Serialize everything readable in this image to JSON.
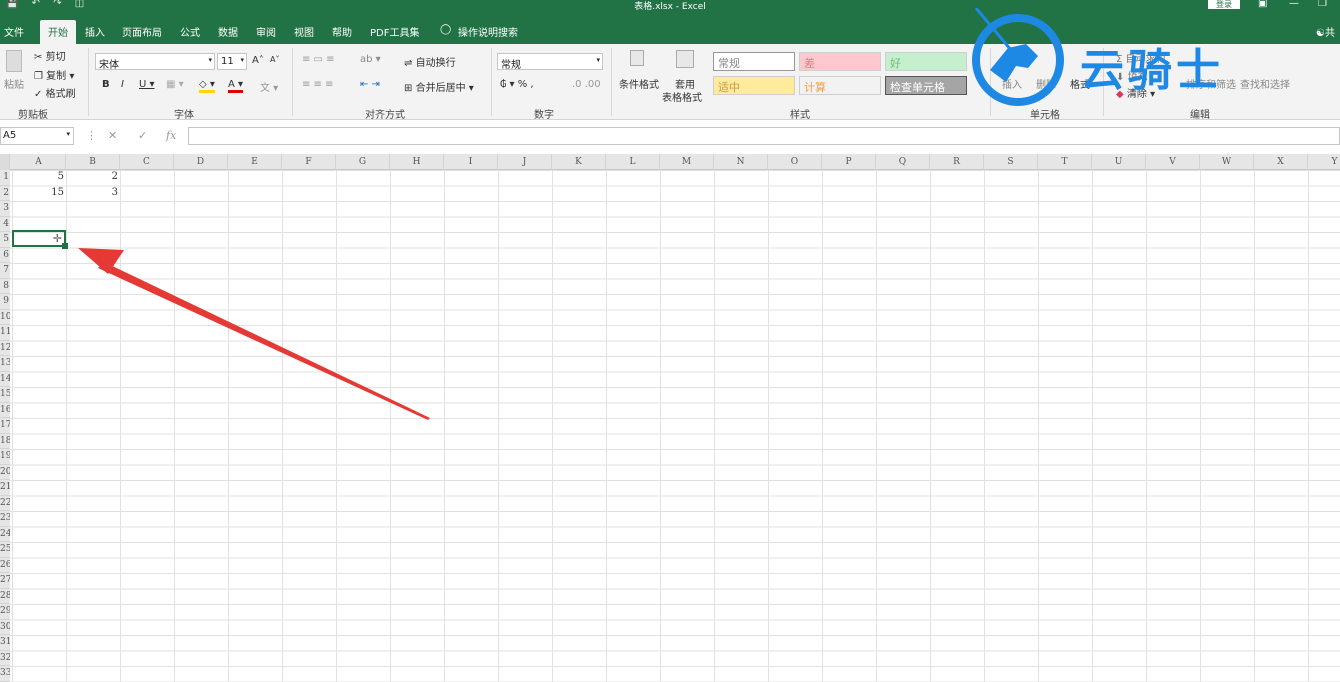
{
  "window": {
    "title": "表格.xlsx - Excel",
    "login_label": "登录"
  },
  "menu": {
    "tabs": [
      "文件",
      "开始",
      "插入",
      "页面布局",
      "公式",
      "数据",
      "审阅",
      "视图",
      "帮助",
      "PDF工具集"
    ],
    "search_label": "操作说明搜索",
    "share_label": "共"
  },
  "ribbon": {
    "clipboard": {
      "paste": "粘贴",
      "cut": "剪切",
      "copy": "复制",
      "painter": "格式刷",
      "label": "剪贴板"
    },
    "font": {
      "name": "宋体",
      "size": "11",
      "label": "字体"
    },
    "alignment": {
      "wrap": "自动换行",
      "merge": "合并后居中",
      "label": "对齐方式"
    },
    "number": {
      "format": "常规",
      "label": "数字"
    },
    "styles": {
      "cond": "条件格式",
      "table1": "套用",
      "table2": "表格格式",
      "normal": "常规",
      "bad": "差",
      "good": "好",
      "neutral": "适中",
      "calc": "计算",
      "check": "检查单元格",
      "label": "样式",
      "colors": {
        "bad_bg": "#ffc7ce",
        "bad_fg": "#9c0006",
        "good_bg": "#c6efce",
        "good_fg": "#006100",
        "neutral_bg": "#ffeb9c",
        "neutral_fg": "#9c5700",
        "calc_bg": "#f2f2f2",
        "calc_fg": "#fa7d00",
        "check_bg": "#a5a5a5"
      }
    },
    "cells": {
      "insert": "插入",
      "delete": "删除",
      "format": "格式",
      "label": "单元格"
    },
    "editing": {
      "autosum": "自动求和",
      "fill": "填充",
      "clear": "清除",
      "sort": "排序和筛选",
      "find": "查找和选择",
      "label": "编辑"
    }
  },
  "formula_bar": {
    "name_box": "A5",
    "fx": "fx",
    "value": ""
  },
  "sheet": {
    "columns": [
      "A",
      "B",
      "C",
      "D",
      "E",
      "F",
      "G",
      "H",
      "I",
      "J",
      "K",
      "L",
      "M",
      "N",
      "O",
      "P",
      "Q",
      "R",
      "S",
      "T",
      "U",
      "V",
      "W",
      "X",
      "Y"
    ],
    "rows": [
      "1",
      "2",
      "3",
      "4",
      "5",
      "6",
      "7",
      "8",
      "9",
      "10",
      "11",
      "12",
      "13",
      "14",
      "15",
      "16",
      "17",
      "18",
      "19",
      "20",
      "21",
      "22",
      "23",
      "24",
      "25",
      "26",
      "27",
      "28",
      "29",
      "30",
      "31",
      "32",
      "33"
    ],
    "values": {
      "A1": "5",
      "B1": "2",
      "A2": "15",
      "B2": "3"
    },
    "selected_cell": "A5"
  },
  "watermark": {
    "text": "云骑士",
    "color": "#1e88e5"
  },
  "accent": "#217346",
  "arrow_color": "#e53935"
}
